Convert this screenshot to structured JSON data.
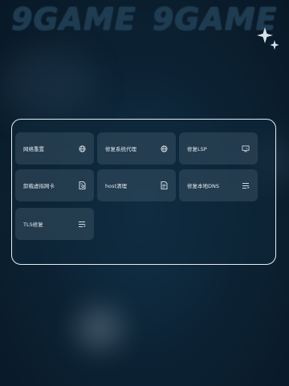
{
  "header": {
    "brand_left": "9GAME",
    "brand_right": "9GAME"
  },
  "tiles": [
    {
      "label": "网络重置",
      "icon": "globe-icon"
    },
    {
      "label": "修复系统代理",
      "icon": "globe-icon"
    },
    {
      "label": "修复LSP",
      "icon": "monitor-icon"
    },
    {
      "label": "卸载虚拟网卡",
      "icon": "document-settings-icon"
    },
    {
      "label": "host清理",
      "icon": "document-icon"
    },
    {
      "label": "修复本地DNS",
      "icon": "list-icon"
    },
    {
      "label": "TLS修复",
      "icon": "list-icon"
    }
  ]
}
